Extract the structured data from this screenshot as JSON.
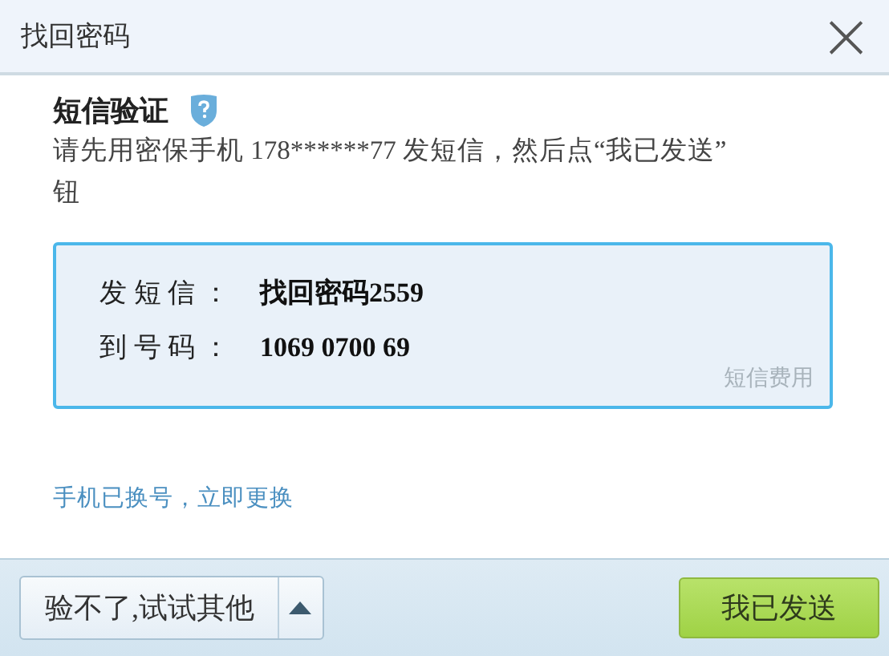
{
  "window": {
    "title": "找回密码",
    "close_glyph": "×"
  },
  "section": {
    "title": "短信验证",
    "description_lines": [
      "请先用密保手机 178******77 发短信，然后点“我已发送”",
      "钮"
    ]
  },
  "sms_box": {
    "rows": [
      {
        "label": "发 短 信 ：",
        "value": "找回密码2559"
      },
      {
        "label": "到 号 码 ：",
        "value": "1069 0700 69"
      }
    ],
    "fee_link": "短信费用"
  },
  "change_link": "手机已换号，立即更换",
  "footer": {
    "other_button": "验不了,试试其他",
    "confirm_button": "我已发送"
  }
}
